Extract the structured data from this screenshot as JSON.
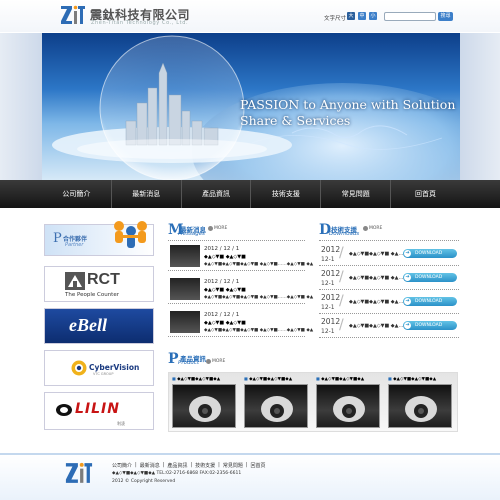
{
  "header": {
    "company_cn": "震鈦科技有限公司",
    "company_en": "Zhen-Titan  Technology  Co., Ltd.",
    "fontsize_label": "文字尺寸",
    "fontsize_buttons": [
      "大",
      "中",
      "小"
    ],
    "search_placeholder": "",
    "search_button": "搜尋"
  },
  "banner": {
    "slogan_line1": "PASSION to Anyone with Solution",
    "slogan_line2": "Share & Services"
  },
  "nav": {
    "items": [
      "公司簡介",
      "最新消息",
      "產品資訊",
      "技術支援",
      "常見問題",
      "回首頁"
    ]
  },
  "sidebar": {
    "partner_title": "合作夥伴",
    "partner_sub": "Partner",
    "rct_word": "RCT",
    "rct_sub": "The People Counter",
    "ebell_word": "eBell",
    "cyber_word": "CyberVision",
    "cyber_sub": "VTC GROUP",
    "lilin_word": "LILIN",
    "lilin_sub": "利凌"
  },
  "news": {
    "title_cn": "最新消息",
    "title_en": "Messages",
    "more_label": "MORE",
    "items": [
      {
        "date": "2012 / 12 / 1",
        "title": "◆▲◇▼■ ◆▲◇▼■",
        "desc": "◆▲◇▼■◆▲◇▼■◆▲◇▼■ ◆▲◇▼■……◆▲◇▼■ ◆▲"
      },
      {
        "date": "2012 / 12 / 1",
        "title": "◆▲◇▼■ ◆▲◇▼■",
        "desc": "◆▲◇▼■◆▲◇▼■◆▲◇▼■ ◆▲◇▼■……◆▲◇▼■ ◆▲"
      },
      {
        "date": "2012 / 12 / 1",
        "title": "◆▲◇▼■ ◆▲◇▼■",
        "desc": "◆▲◇▼■◆▲◇▼■◆▲◇▼■ ◆▲◇▼■……◆▲◇▼■ ◆▲"
      }
    ]
  },
  "downloads": {
    "title_cn": "技術支援",
    "title_en": "Downloads",
    "more_label": "MORE",
    "button_label": "DOWNLOAD",
    "items": [
      {
        "year": "2012",
        "day": "12-1",
        "name": "◆▲◇▼■◆▲◇▼■ ◆▲……"
      },
      {
        "year": "2012",
        "day": "12-1",
        "name": "◆▲◇▼■◆▲◇▼■ ◆▲……"
      },
      {
        "year": "2012",
        "day": "12-1",
        "name": "◆▲◇▼■◆▲◇▼■ ◆▲……"
      },
      {
        "year": "2012",
        "day": "12-1",
        "name": "◆▲◇▼■◆▲◇▼■ ◆▲……"
      }
    ]
  },
  "products": {
    "title_cn": "產品資訊",
    "title_en": "Product",
    "more_label": "MORE",
    "items": [
      {
        "name": "◆▲◇▼■◆▲◇▼■◆▲"
      },
      {
        "name": "◆▲◇▼■◆▲◇▼■◆▲"
      },
      {
        "name": "◆▲◇▼■◆▲◇▼■◆▲"
      },
      {
        "name": "◆▲◇▼■◆▲◇▼■◆▲"
      }
    ]
  },
  "footer": {
    "links": [
      "公司簡介",
      "最新消息",
      "產品資訊",
      "技術支援",
      "常見問題",
      "回首頁"
    ],
    "address": "◆▲◇▼■◆▲◇▼■◆▲ TEL:02-2716-6868 FAX:02-2356-6611",
    "copyright": "2012 © Copyright Reserved"
  },
  "colors": {
    "accent": "#2a6fb8",
    "nav_bg": "#1e1e1e",
    "download_btn": "#2b91c8",
    "lilin_red": "#c81414"
  }
}
